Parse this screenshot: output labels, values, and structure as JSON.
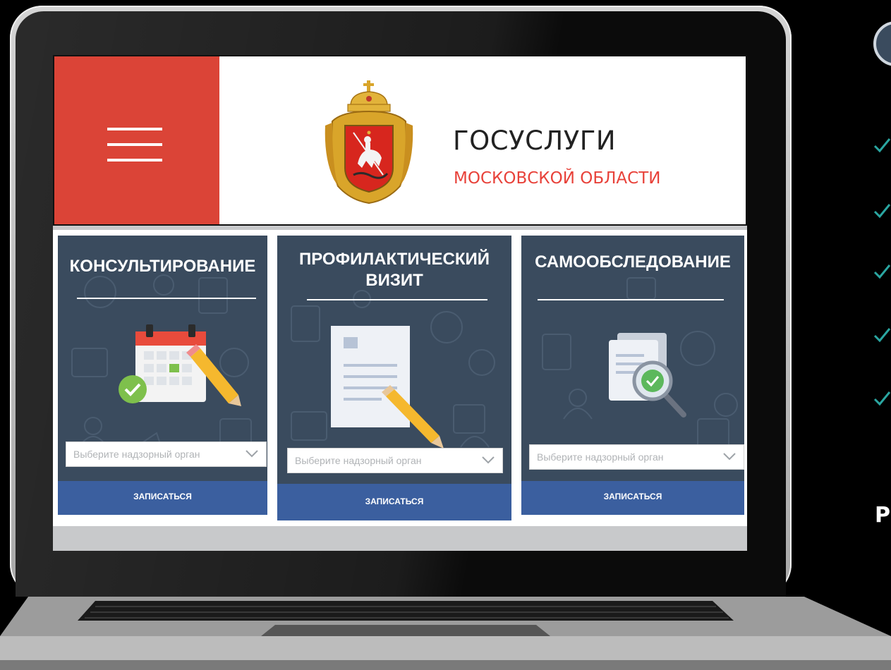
{
  "brand": {
    "title": "ГОСУСЛУГИ",
    "subtitle": "МОСКОВСКОЙ ОБЛАСТИ",
    "accent": "#db4437",
    "subtitle_color": "#e8423a"
  },
  "cards": [
    {
      "title_lines": [
        "КОНСУЛЬТИРОВАНИЕ"
      ],
      "select_placeholder": "Выберите надзорный орган",
      "button_label": "ЗАПИСАТЬСЯ",
      "icon": "calendar-icon"
    },
    {
      "title_lines": [
        "ПРОФИЛАКТИЧЕСКИЙ",
        "ВИЗИТ"
      ],
      "select_placeholder": "Выберите надзорный орган",
      "button_label": "ЗАПИСАТЬСЯ",
      "icon": "document-icon"
    },
    {
      "title_lines": [
        "САМООБСЛЕДОВАНИЕ"
      ],
      "select_placeholder": "Выберите надзорный орган",
      "button_label": "ЗАПИСАТЬСЯ",
      "icon": "magnifier-document-icon"
    }
  ],
  "colors": {
    "card_bg": "#3a4b5e",
    "button_bg": "#3b5f9f",
    "check": "#2aa6a1"
  },
  "right_panel": {
    "partial_letter": "Р",
    "check_count": 5
  }
}
